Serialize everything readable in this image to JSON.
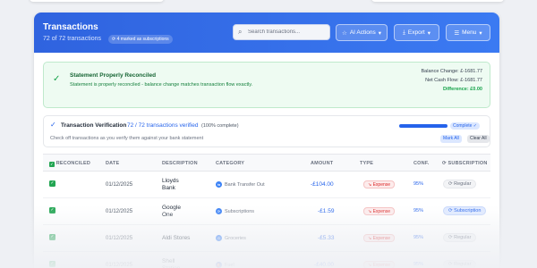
{
  "header": {
    "title": "Transactions",
    "subtitle": "72 of 72 transactions",
    "badge": "4 marked as subscriptions",
    "search_placeholder": "Search transactions...",
    "buttons": {
      "ai": "AI Actions",
      "export": "Export",
      "menu": "Menu"
    }
  },
  "reconcile": {
    "title": "Statement Properly Reconciled",
    "message": "Statement is properly reconciled - balance change matches transaction flow exactly.",
    "balance_change": "Balance Change: £-1681.77",
    "net_cash_flow": "Net Cash Flow: £-1681.77",
    "difference": "Difference: £0.00"
  },
  "verification": {
    "title": "Transaction Verification",
    "count": "72 / 72 transactions verified",
    "percent": "(100% complete)",
    "hint": "Check off transactions as you verify them against your bank statement",
    "progress": 1.0,
    "status": "Complete",
    "mark_all": "Mark All",
    "clear_all": "Clear All"
  },
  "table": {
    "columns": [
      "RECONCILED",
      "DATE",
      "DESCRIPTION",
      "CATEGORY",
      "AMOUNT",
      "TYPE",
      "CONF.",
      "SUBSCRIPTION"
    ],
    "rows": [
      {
        "date": "01/12/2025",
        "desc": "Lloyds\nBank",
        "category": "Bank Transfer Out",
        "amount": "-£104.00",
        "type": "Expense",
        "conf": "95%",
        "subscription": "Regular"
      },
      {
        "date": "01/12/2025",
        "desc": "Google\nOne",
        "category": "Subscriptions",
        "amount": "-£1.59",
        "type": "Expense",
        "conf": "95%",
        "subscription": "Subscription"
      },
      {
        "date": "01/12/2025",
        "desc": "Aldi Stores",
        "category": "Groceries",
        "amount": "-£5.33",
        "type": "Expense",
        "conf": "95%",
        "subscription": "Regular"
      },
      {
        "date": "01/12/2025",
        "desc": "Shell\nStation",
        "category": "Fuel",
        "amount": "-£40.00",
        "type": "Expense",
        "conf": "95%",
        "subscription": "Regular"
      }
    ]
  },
  "colors": {
    "accent": "#2f63df",
    "success": "#16a34a",
    "expense": "#dc2626"
  }
}
